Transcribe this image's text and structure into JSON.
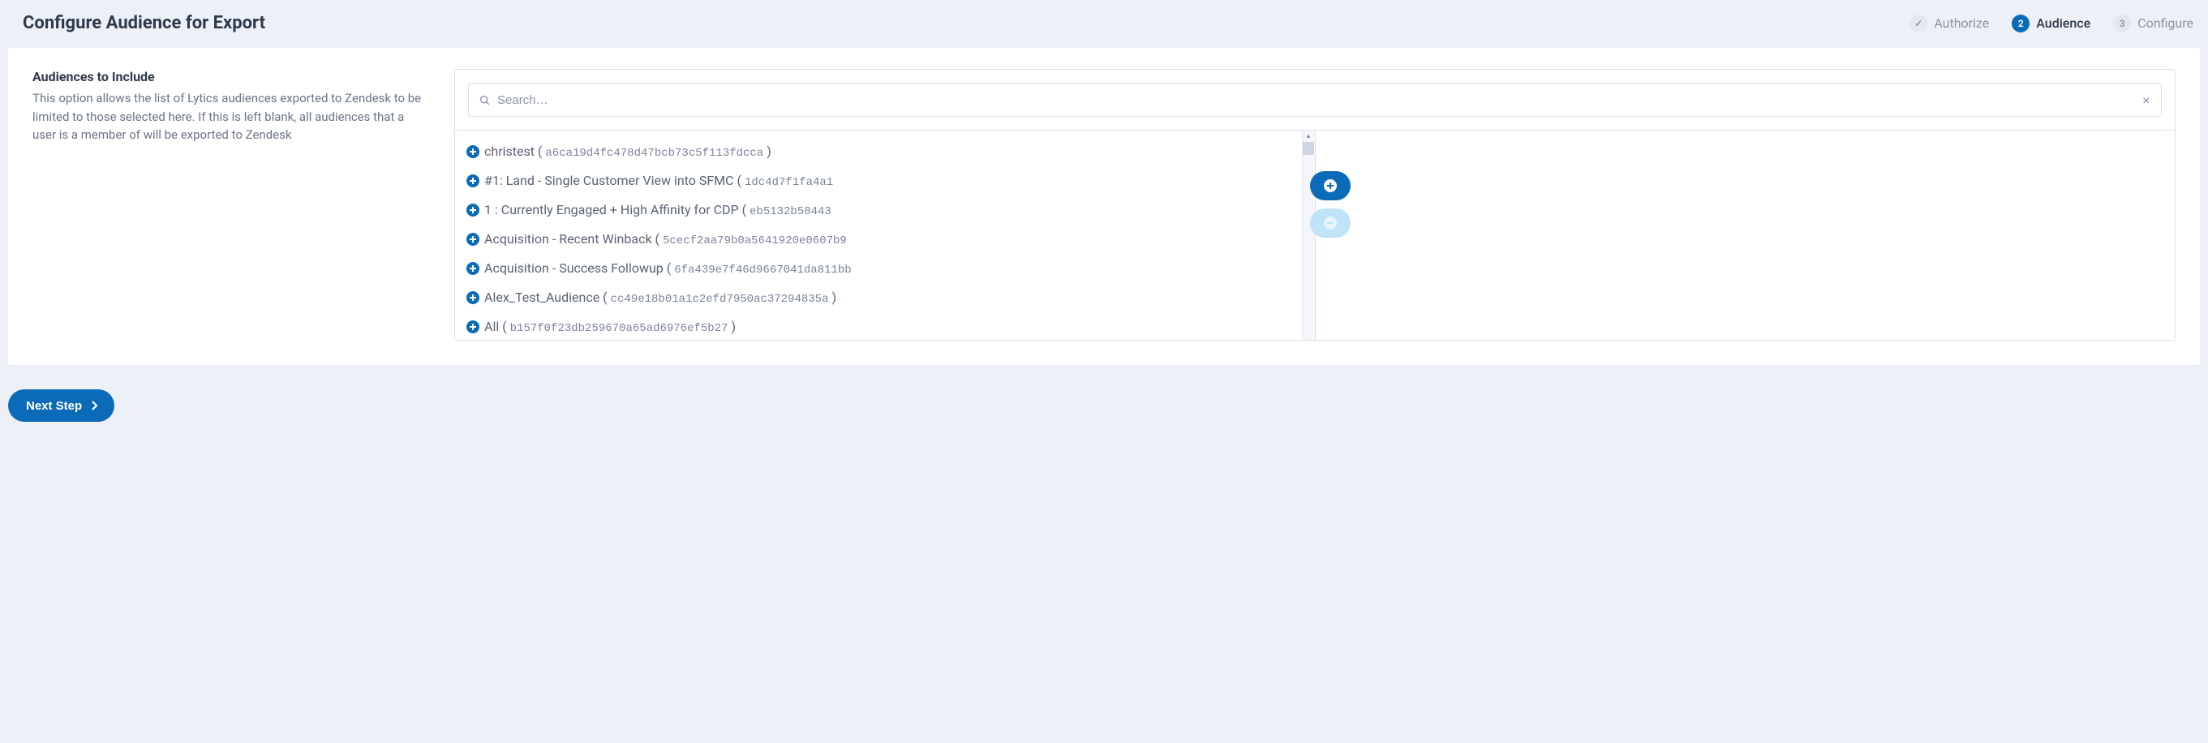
{
  "header": {
    "title": "Configure Audience for Export"
  },
  "stepper": {
    "steps": [
      {
        "marker": "✓",
        "label": "Authorize",
        "state": "done"
      },
      {
        "marker": "2",
        "label": "Audience",
        "state": "active"
      },
      {
        "marker": "3",
        "label": "Configure",
        "state": "future"
      }
    ]
  },
  "section": {
    "title": "Audiences to Include",
    "description": "This option allows the list of Lytics audiences exported to Zendesk to be limited to those selected here. If this is left blank, all audiences that a user is a member of will be exported to Zendesk"
  },
  "search": {
    "placeholder": "Search…",
    "value": ""
  },
  "audiences": [
    {
      "name": "christest",
      "hash": "a6ca19d4fc478d47bcb73c5f113fdcca",
      "closed": true
    },
    {
      "name": "#1: Land - Single Customer View into SFMC",
      "hash": "1dc4d7f1fa4a1",
      "closed": false
    },
    {
      "name": "1 : Currently Engaged + High Affinity for CDP",
      "hash": "eb5132b58443",
      "closed": false
    },
    {
      "name": "Acquisition - Recent Winback",
      "hash": "5cecf2aa79b0a5641920e0607b9",
      "closed": false
    },
    {
      "name": "Acquisition - Success Followup",
      "hash": "6fa439e7f46d9667041da811bb",
      "closed": false
    },
    {
      "name": "Alex_Test_Audience",
      "hash": "cc49e18b01a1c2efd7950ac37294835a",
      "closed": true
    },
    {
      "name": "All",
      "hash": "b157f0f23db259670a65ad6976ef5b27",
      "closed": true
    }
  ],
  "footer": {
    "next_label": "Next Step"
  }
}
